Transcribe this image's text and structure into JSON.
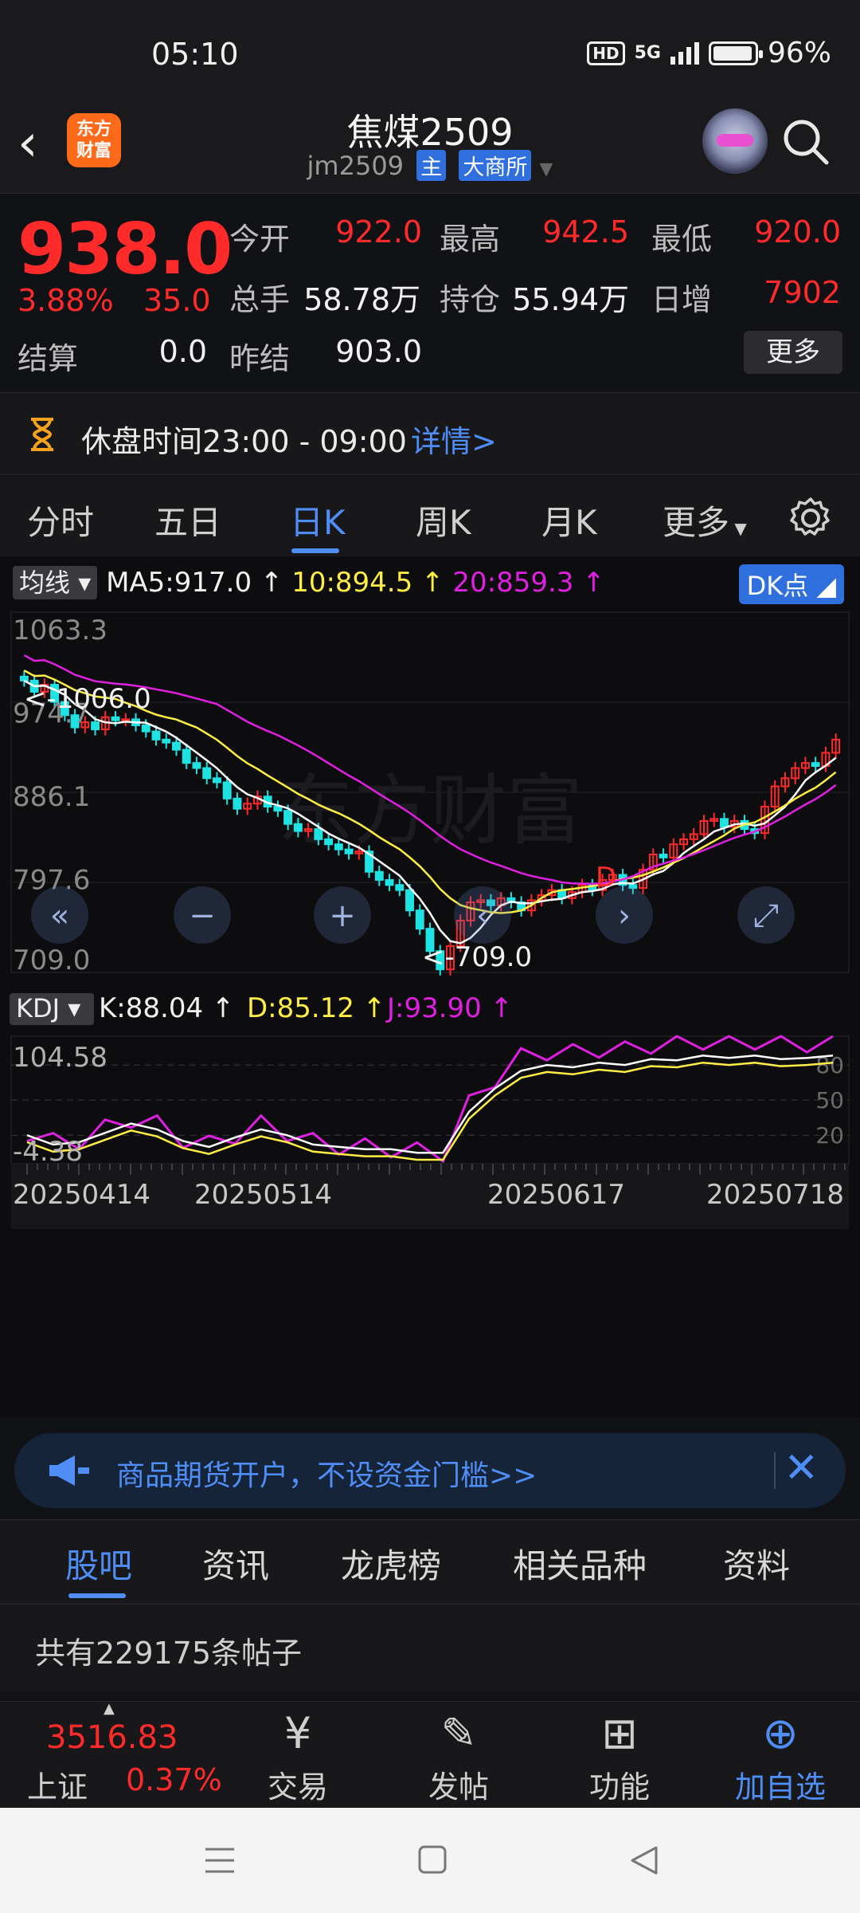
{
  "status": {
    "time": "05:10",
    "hd": "HD",
    "network": "5G",
    "battery": "96%",
    "battery_level": 0.96
  },
  "header": {
    "logo_line1": "东方",
    "logo_line2": "财富",
    "title": "焦煤2509",
    "code": "jm2509",
    "tag_main": "主",
    "tag_exchange": "大商所"
  },
  "quote": {
    "price": "938.0",
    "pct": "3.88%",
    "change": "35.0",
    "open_label": "今开",
    "open": "922.0",
    "high_label": "最高",
    "high": "942.5",
    "low_label": "最低",
    "low": "920.0",
    "volume_label": "总手",
    "volume": "58.78万",
    "oi_label": "持仓",
    "oi": "55.94万",
    "daily_inc_label": "日增",
    "daily_inc": "7902",
    "settle_label": "结算",
    "settle": "0.0",
    "prev_settle_label": "昨结",
    "prev_settle": "903.0",
    "more": "更多"
  },
  "recess": {
    "text": "休盘时间23:00 - 09:00",
    "details": "详情>"
  },
  "tabs": [
    "分时",
    "五日",
    "日K",
    "周K",
    "月K",
    "更多"
  ],
  "active_tab": 2,
  "chart_overlay": {
    "ma_pill": "均线",
    "ma5": "MA5:917.0",
    "ma10": "10:894.5",
    "ma20": "20:859.3",
    "dk": "DK点",
    "y_labels": [
      "1063.3",
      "974.7",
      "886.1",
      "797.6",
      "709.0"
    ],
    "max_note": "<-1006.0",
    "min_note": "<-709.0",
    "d_marker": "D",
    "kdj_pill": "KDJ",
    "k": "K:88.04",
    "d": "D:85.12",
    "j": "J:93.90",
    "kdj_top": "104.58",
    "kdj_bottom": "-4.38",
    "kdj_80": "80",
    "kdj_50": "50",
    "kdj_20": "20",
    "dates": [
      "20250414",
      "20250514",
      "20250617",
      "20250718"
    ]
  },
  "chart_data": {
    "type": "candlestick",
    "ylim": [
      709.0,
      1063.3
    ],
    "up_color": "#ff2a2a",
    "down_color": "#1fe3e3",
    "ma_colors": {
      "ma5": "#ffffff",
      "ma10": "#ffee44",
      "ma20": "#e020e0"
    },
    "close": [
      996,
      985,
      992,
      975,
      962,
      950,
      955,
      948,
      960,
      957,
      958,
      952,
      946,
      938,
      935,
      928,
      915,
      910,
      900,
      896,
      880,
      870,
      875,
      882,
      872,
      868,
      855,
      848,
      850,
      840,
      835,
      830,
      826,
      828,
      808,
      800,
      795,
      790,
      770,
      752,
      730,
      712,
      735,
      760,
      778,
      780,
      775,
      782,
      778,
      770,
      780,
      785,
      790,
      782,
      788,
      795,
      790,
      800,
      805,
      795,
      792,
      810,
      825,
      822,
      835,
      840,
      845,
      858,
      860,
      852,
      858,
      850,
      846,
      872,
      892,
      900,
      910,
      915,
      912,
      925,
      938
    ],
    "kdj_k": [
      20,
      12,
      14,
      22,
      30,
      25,
      15,
      10,
      18,
      25,
      20,
      12,
      10,
      8,
      8,
      5,
      5,
      40,
      60,
      75,
      80,
      78,
      82,
      80,
      85,
      84,
      88,
      86,
      88,
      85,
      86,
      88
    ],
    "kdj_ylim": [
      -4.38,
      104.58
    ]
  },
  "banner": {
    "text": "商品期货开户，不设资金门槛>>",
    "close": "✕"
  },
  "subtabs": [
    "股吧",
    "资讯",
    "龙虎榜",
    "相关品种",
    "资料"
  ],
  "posts": "共有229175条帖子",
  "bottom_nav": {
    "index_value": "3516.83",
    "index_name": "上证",
    "index_pct": "0.37%",
    "items": [
      "交易",
      "发帖",
      "功能",
      "加自选"
    ]
  }
}
